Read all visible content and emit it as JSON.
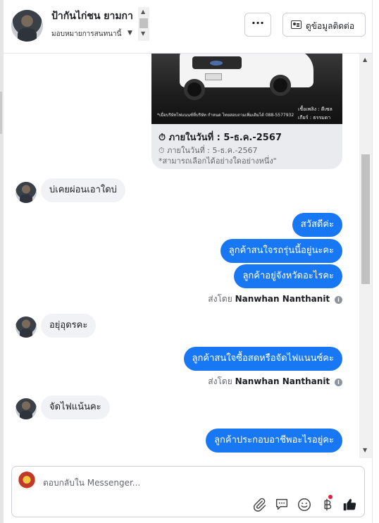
{
  "header": {
    "name": "ป้ากันไก่ชน ยามกา",
    "assign_label": "มอบหมายการสนทนานี้",
    "more_label": "···",
    "contact_button": "ดูข้อมูลติดต่อ"
  },
  "card": {
    "image_caption": "*เมื่อบริษัทไฟแนนซ์ที่บริษัท กำหนด ไทยสอบถามเพิ่มเติมได้ 088-5577932",
    "spec_fuel": "เชื้อเพลิง : ดีเซล",
    "spec_gear": "เกียร์ : ธรรมดา",
    "title": "⏱ ภายในวันที่ : 5-ธ.ค.-2567",
    "subtitle": "⏱ ภายในวันที่ : 5-ธ.ค.-2567",
    "note": "*สามารถเลือกได้อย่างใดอย่างหนึ่ง\""
  },
  "messages": [
    {
      "dir": "in",
      "text": "บ่เคยผ่อนเอาใดบ่"
    },
    {
      "dir": "out",
      "text": "สวัสดีค่ะ"
    },
    {
      "dir": "out",
      "text": "ลูกค้าสนใจรถรุ่นนี้อยู่นะคะ"
    },
    {
      "dir": "out",
      "text": "ลูกค้าอยู่จังหวัดอะไรคะ"
    },
    {
      "dir": "in",
      "text": "อยุ่อุดรคะ"
    },
    {
      "dir": "out",
      "text": "ลูกค้าสนใจซื้อสดหรือจัดไฟแนนซ์คะ"
    },
    {
      "dir": "in",
      "text": "จัดไฟแน้นคะ"
    },
    {
      "dir": "out",
      "text": "ลูกค้าประกอบอาชีพอะไรอยู่คะ"
    }
  ],
  "sent_by": {
    "prefix": "ส่งโดย",
    "name": "Nanwhan Nanthanit",
    "info_icon": "i"
  },
  "composer": {
    "placeholder": "ตอบกลับใน Messenger..."
  },
  "icons": {
    "attach": "paperclip-icon",
    "saved_reply": "speech-bubble-icon",
    "emoji": "smiley-icon",
    "payment": "baht-icon",
    "like": "thumbs-up-icon"
  },
  "colors": {
    "outgoing_bubble": "#1877f2",
    "incoming_bubble": "#f0f2f5",
    "like_icon": "#1c1e21"
  }
}
